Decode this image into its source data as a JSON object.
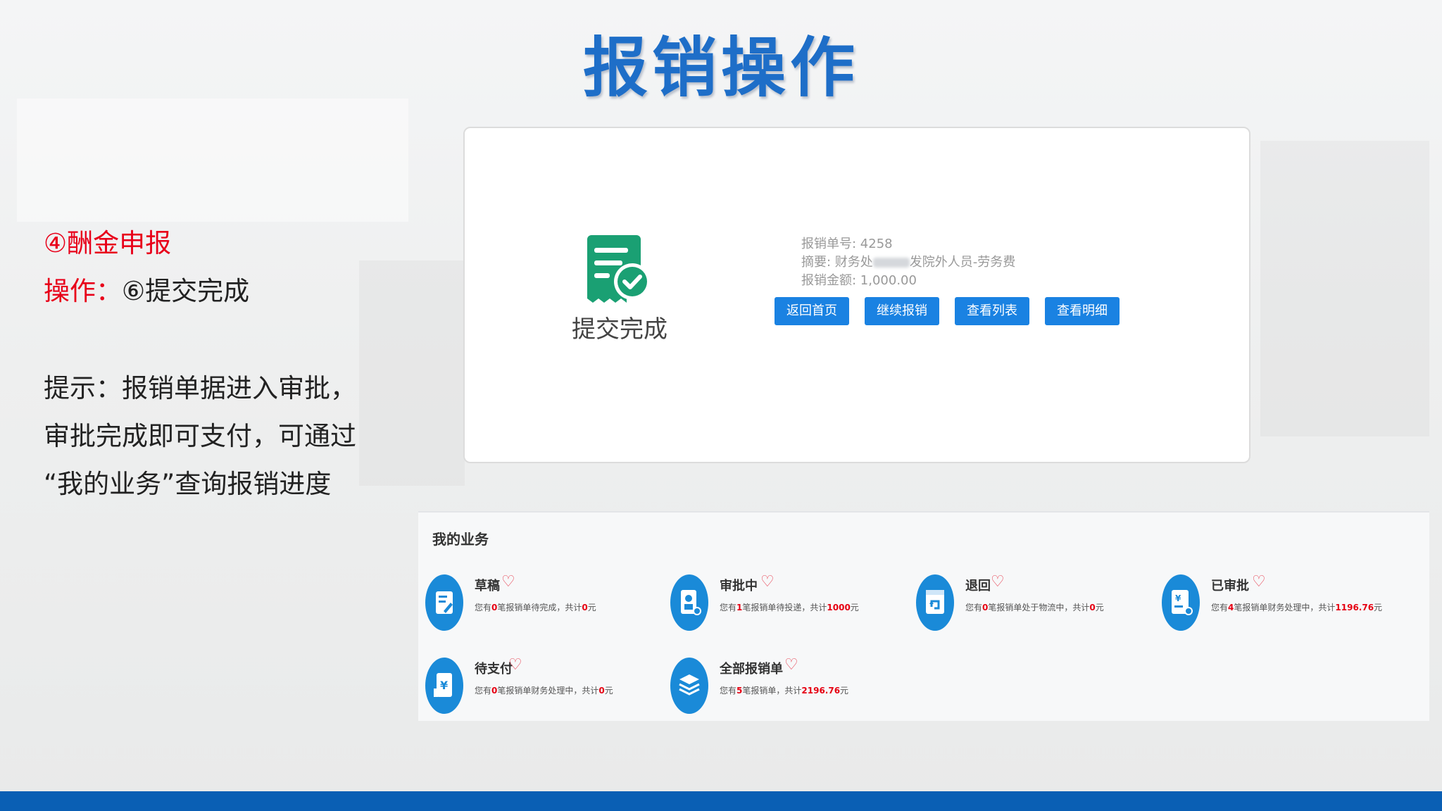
{
  "slide": {
    "title": "报销操作"
  },
  "left": {
    "step_label": "④酬金申报",
    "op_prefix": "操作：",
    "op_value": "⑥提交完成",
    "tip_line1": "提示：报销单据进入审批，",
    "tip_line2": "审批完成即可支付，可通过",
    "tip_line3": "“我的业务”查询报销进度"
  },
  "result_card": {
    "status_text": "提交完成",
    "order_no": "报销单号: 4258",
    "summary_prefix": "摘要: 财务处",
    "summary_suffix": "发院外人员-劳务费",
    "amount": "报销金额: 1,000.00",
    "buttons": [
      "返回首页",
      "继续报销",
      "查看列表",
      "查看明细"
    ]
  },
  "my_business": {
    "title": "我的业务",
    "items": [
      {
        "name": "草稿",
        "desc_pre": "您有",
        "count": "0",
        "desc_mid": "笔报销单待完成，共计",
        "total": "0",
        "desc_post": "元"
      },
      {
        "name": "审批中",
        "desc_pre": "您有",
        "count": "1",
        "desc_mid": "笔报销单待投递，共计",
        "total": "1000",
        "desc_post": "元"
      },
      {
        "name": "退回",
        "desc_pre": "您有",
        "count": "0",
        "desc_mid": "笔报销单处于物流中，共计",
        "total": "0",
        "desc_post": "元"
      },
      {
        "name": "已审批",
        "desc_pre": "您有",
        "count": "4",
        "desc_mid": "笔报销单财务处理中，共计",
        "total": "1196.76",
        "desc_post": "元"
      },
      {
        "name": "待支付",
        "desc_pre": "您有",
        "count": "0",
        "desc_mid": "笔报销单财务处理中，共计",
        "total": "0",
        "desc_post": "元"
      },
      {
        "name": "全部报销单",
        "desc_pre": "您有",
        "count": "5",
        "desc_mid": "笔报销单，共计",
        "total": "2196.76",
        "desc_post": "元"
      }
    ]
  },
  "colors": {
    "title_blue": "#1e6ec8",
    "button_blue": "#1a82e2",
    "highlight_red": "#e60012",
    "step_red": "#e8001a",
    "footer_blue": "#0a5fb4",
    "success_green": "#1aa073"
  },
  "icons": [
    "success-document-check-icon",
    "heart-icon",
    "draft-icon",
    "approving-icon",
    "returned-icon",
    "approved-icon",
    "pending-payment-icon",
    "all-orders-icon"
  ]
}
